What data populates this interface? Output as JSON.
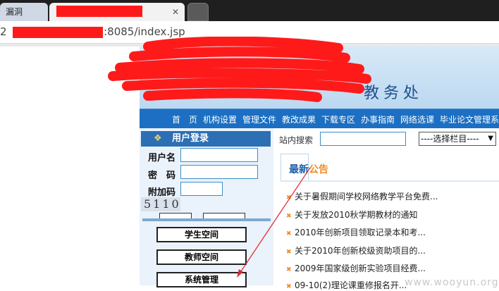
{
  "browser": {
    "tabs": [
      {
        "title": "漏洞"
      },
      {
        "title": ""
      },
      {
        "title": ""
      }
    ],
    "address": {
      "url_visible": "2",
      "url_suffix": "5:8085/index.jsp"
    }
  },
  "banner": {
    "title": "教务处"
  },
  "nav": {
    "items": [
      "首　页",
      "机构设置",
      "管理文件",
      "教改成果",
      "下载专区",
      "办事指南",
      "网络选课",
      "毕业论文管理系"
    ]
  },
  "login": {
    "header": "用户登录",
    "username_label": "用户名",
    "password_label": "密　码",
    "captcha_label": "附加码",
    "captcha_value": "5110",
    "spaces": [
      "学生空间",
      "教师空间",
      "系统管理"
    ]
  },
  "search": {
    "label": "站内搜索",
    "select_value": "----选择栏目----"
  },
  "news": {
    "title_part1": "最新",
    "title_part2": "公告",
    "items": [
      "关于暑假期间学校网络教学平台免费...",
      "关于发放2010秋学期教材的通知",
      "2010年创新项目领取记录本和考...",
      "关于2010年创新校级资助项目的...",
      "2009年国家级创新实验项目经费...",
      "09-10(2)理论课重修报名开..."
    ]
  },
  "watermark": "www.wooyun.org",
  "colors": {
    "nav_blue": "#1c6fc2",
    "redaction": "#ff1a1a",
    "accent_orange": "#f08b2a"
  }
}
